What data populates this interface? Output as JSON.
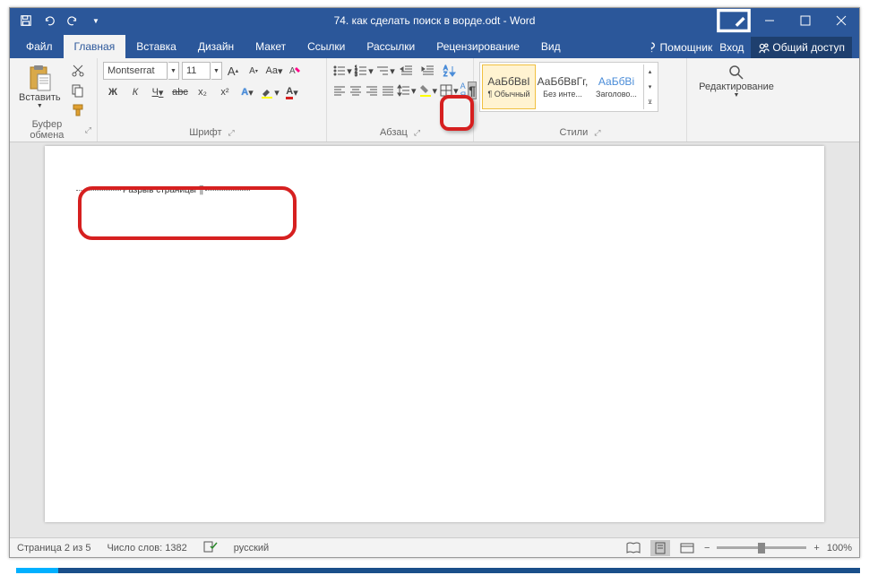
{
  "title": "74. как сделать поиск в ворде.odt - Word",
  "tabs": {
    "file": "Файл",
    "home": "Главная",
    "insert": "Вставка",
    "design": "Дизайн",
    "layout": "Макет",
    "references": "Ссылки",
    "mailings": "Рассылки",
    "review": "Рецензирование",
    "view": "Вид"
  },
  "assistant": "Помощник",
  "signin": "Вход",
  "share": "Общий доступ",
  "groups": {
    "clipboard": "Буфер обмена",
    "font": "Шрифт",
    "paragraph": "Абзац",
    "styles": "Стили",
    "editing": "Редактирование"
  },
  "paste": "Вставить",
  "font": {
    "name": "Montserrat",
    "size": "11"
  },
  "font_btns": {
    "bold": "Ж",
    "italic": "К",
    "underline": "Ч",
    "strike": "abc",
    "sub": "x₂",
    "sup": "x²",
    "aa": "Aa",
    "grow": "A",
    "shrink": "A"
  },
  "styles": [
    {
      "preview": "АаБбВвІ",
      "label": "¶ Обычный",
      "selected": true
    },
    {
      "preview": "АаБбВвГг,",
      "label": "Без инте..."
    },
    {
      "preview": "АаБбВі",
      "label": "Заголово...",
      "heading": true
    }
  ],
  "document": {
    "page_break": "Разрыв страницы",
    "pilcrow": "¶"
  },
  "status": {
    "page": "Страница 2 из 5",
    "words": "Число слов: 1382",
    "language": "русский",
    "zoom": "100%"
  }
}
